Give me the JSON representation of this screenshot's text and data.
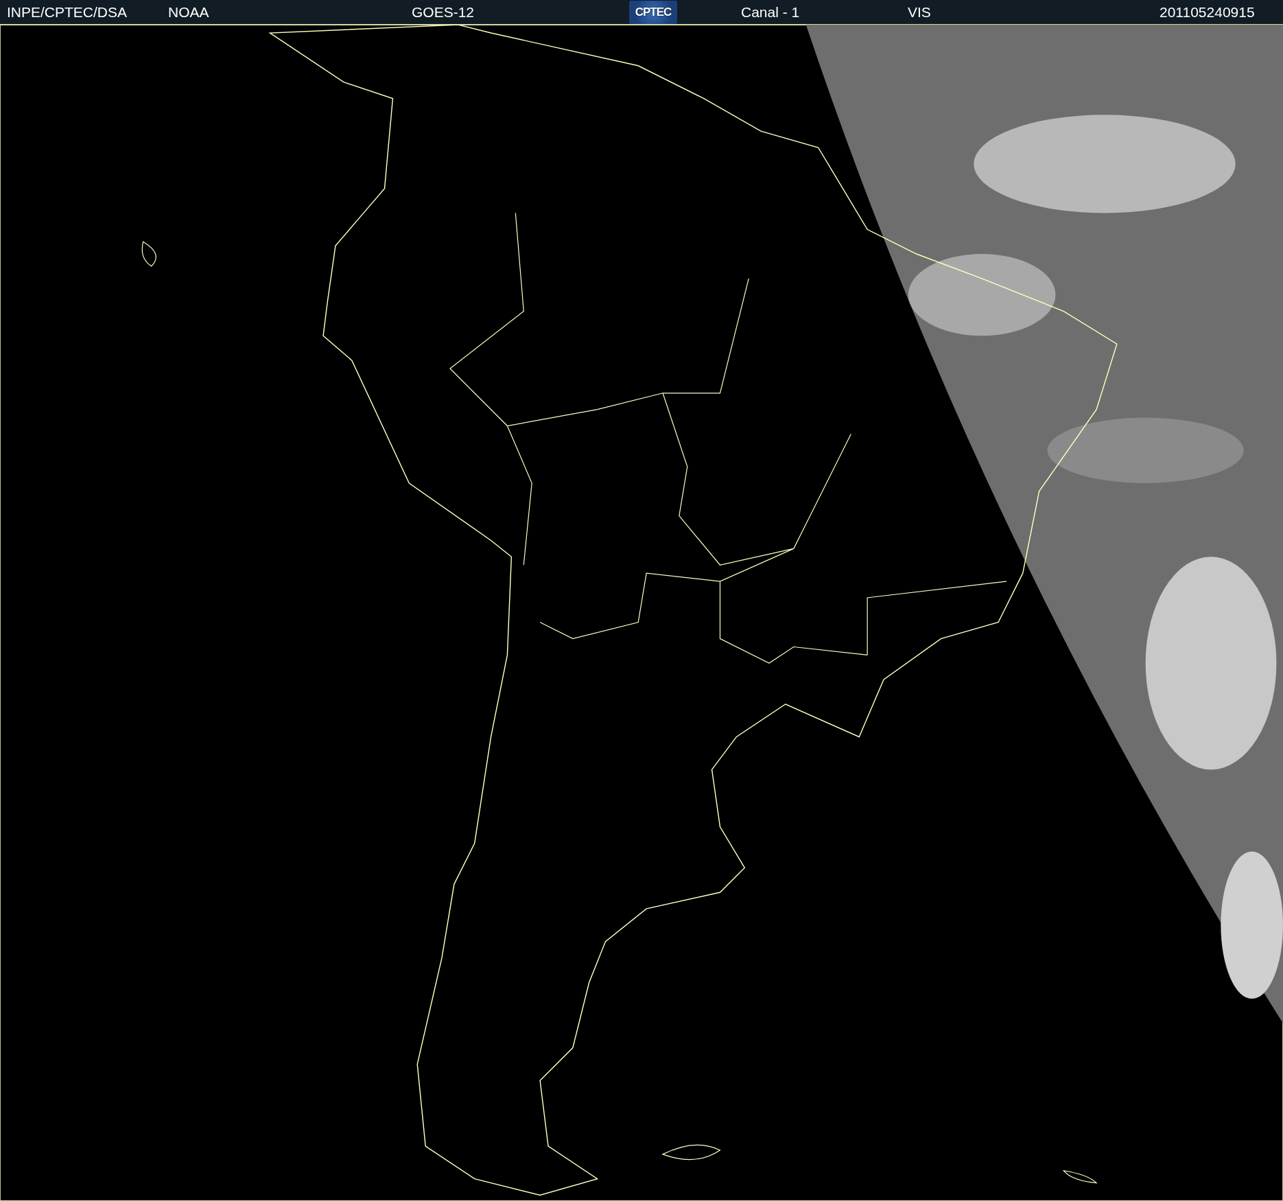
{
  "header": {
    "items": [
      {
        "kind": "text",
        "text": "INPE/CPTEC/DSA"
      },
      {
        "kind": "text",
        "text": "NOAA"
      },
      {
        "kind": "text",
        "text": "GOES-12"
      },
      {
        "kind": "logo",
        "text": "CPTEC"
      },
      {
        "kind": "text",
        "text": "Canal - 1"
      },
      {
        "kind": "text",
        "text": "VIS"
      },
      {
        "kind": "text",
        "text": "201105240915"
      }
    ]
  },
  "image": {
    "kind": "map-picture"
  }
}
